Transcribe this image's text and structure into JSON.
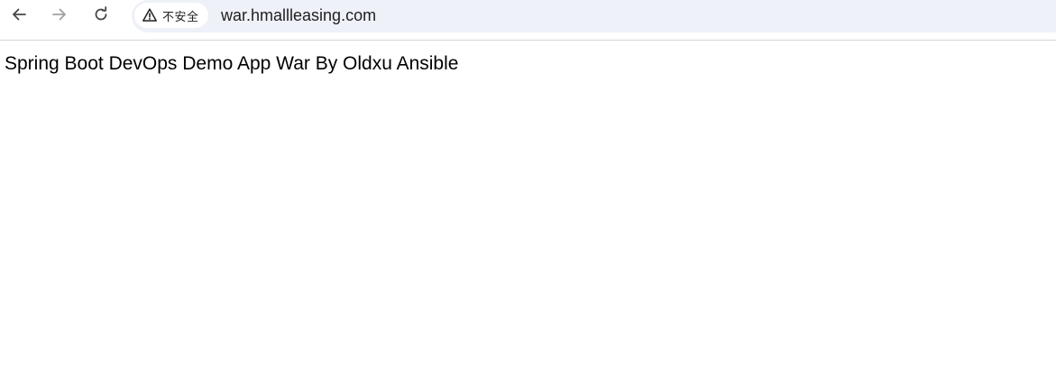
{
  "browser": {
    "toolbar": {
      "back_icon": "arrow-left-icon",
      "forward_icon": "arrow-right-icon",
      "reload_icon": "reload-icon"
    },
    "omnibox": {
      "security_icon": "warning-triangle-icon",
      "security_label": "不安全",
      "url": "war.hmallleasing.com"
    }
  },
  "page": {
    "heading": "Spring Boot DevOps Demo App War By Oldxu Ansible"
  },
  "colors": {
    "omnibox_bg": "#eef1f8",
    "icon": "#474747",
    "icon_disabled": "#a0a0a0",
    "text": "#1f1f1f"
  }
}
